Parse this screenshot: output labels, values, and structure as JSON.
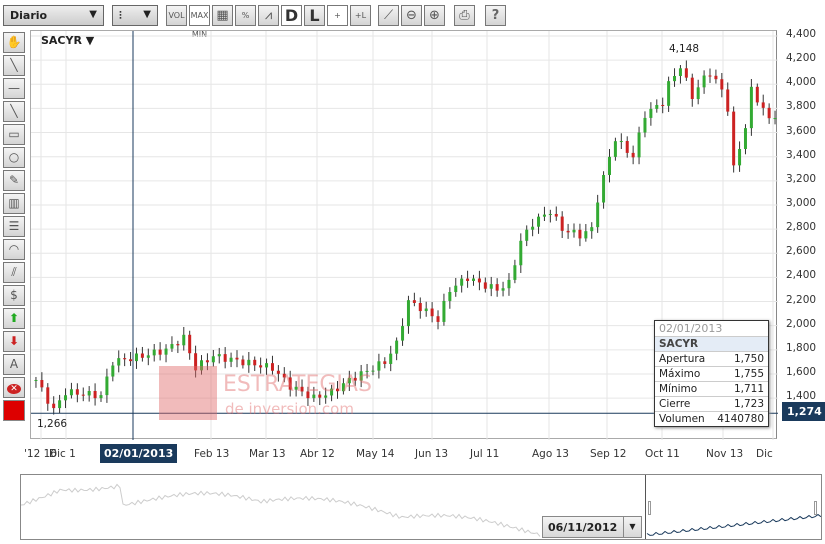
{
  "toolbar": {
    "period": "Diario",
    "chart_type_icon": "candlestick-icon",
    "buttons": [
      {
        "name": "volume",
        "label": "VOL"
      },
      {
        "name": "maxmin",
        "label": "MAX MIN"
      },
      {
        "name": "grid",
        "label": ""
      },
      {
        "name": "percent",
        "label": "%"
      },
      {
        "name": "area",
        "label": ""
      },
      {
        "name": "d",
        "label": "D"
      },
      {
        "name": "l",
        "label": "L"
      },
      {
        "name": "crosshair",
        "label": "+"
      },
      {
        "name": "crosshair-l",
        "label": "+L"
      },
      {
        "name": "draw",
        "label": ""
      },
      {
        "name": "zoom-out",
        "label": ""
      },
      {
        "name": "zoom-in",
        "label": ""
      },
      {
        "name": "print",
        "label": ""
      },
      {
        "name": "help",
        "label": "?"
      }
    ]
  },
  "left_tools": [
    "hand",
    "line",
    "horizontal-line",
    "diagonal",
    "rectangle",
    "circle",
    "pencil",
    "fibonacci-grid",
    "fibonacci-lines",
    "arcs",
    "channel",
    "dollar-channel",
    "up-arrow",
    "down-arrow",
    "text",
    "delete",
    "color"
  ],
  "symbol": "SACYR ▼",
  "watermark": {
    "title": "ESTRATEGIAS",
    "subtitle": "de inversion.com"
  },
  "cursor": {
    "date": "02/01/2013",
    "price": "1,274"
  },
  "labels": {
    "max": "4,148",
    "min": "1,266"
  },
  "tooltip": {
    "date": "02/01/2013",
    "symbol": "SACYR",
    "rows": [
      {
        "k": "Apertura",
        "v": "1,750"
      },
      {
        "k": "Máximo",
        "v": "1,755"
      },
      {
        "k": "Mínimo",
        "v": "1,711"
      },
      {
        "k": "Cierre",
        "v": "1,723"
      },
      {
        "k": "Volumen",
        "v": "4140780"
      }
    ]
  },
  "navigator": {
    "date": "06/11/2012"
  },
  "colors": {
    "up": "#33aa33",
    "down": "#cc2222",
    "crosshair": "#1a3a5c"
  },
  "chart_data": {
    "type": "candlestick",
    "title": "SACYR",
    "ylim": [
      1200,
      4450
    ],
    "yticks": [
      "4,400",
      "4,200",
      "4,000",
      "3,800",
      "3,600",
      "3,400",
      "3,200",
      "3,000",
      "2,800",
      "2,600",
      "2,400",
      "2,200",
      "2,000",
      "1,800",
      "1,600",
      "1,400"
    ],
    "xticks": [
      "'12 16",
      "Dic 1",
      "Feb 13",
      "Mar 13",
      "Abr 12",
      "May 14",
      "Jun 13",
      "Jul 11",
      "Ago 13",
      "Sep 12",
      "Oct 11",
      "Nov 13",
      "Dic"
    ],
    "close_anchors": [
      [
        0,
        1550
      ],
      [
        3,
        1300
      ],
      [
        5,
        1450
      ],
      [
        11,
        1420
      ],
      [
        13,
        1700
      ],
      [
        18,
        1750
      ],
      [
        22,
        1800
      ],
      [
        25,
        1900
      ],
      [
        27,
        1650
      ],
      [
        30,
        1750
      ],
      [
        35,
        1700
      ],
      [
        40,
        1650
      ],
      [
        43,
        1500
      ],
      [
        47,
        1400
      ],
      [
        50,
        1450
      ],
      [
        53,
        1550
      ],
      [
        57,
        1650
      ],
      [
        59,
        1700
      ],
      [
        61,
        1850
      ],
      [
        63,
        2200
      ],
      [
        65,
        2150
      ],
      [
        68,
        2050
      ],
      [
        70,
        2300
      ],
      [
        73,
        2400
      ],
      [
        75,
        2350
      ],
      [
        78,
        2300
      ],
      [
        80,
        2350
      ],
      [
        82,
        2700
      ],
      [
        84,
        2850
      ],
      [
        87,
        2950
      ],
      [
        89,
        2800
      ],
      [
        92,
        2750
      ],
      [
        94,
        2800
      ],
      [
        95,
        3050
      ],
      [
        97,
        3400
      ],
      [
        98,
        3550
      ],
      [
        101,
        3400
      ],
      [
        103,
        3750
      ],
      [
        106,
        3850
      ],
      [
        107,
        4000
      ],
      [
        109,
        4150
      ],
      [
        111,
        3900
      ],
      [
        113,
        4050
      ],
      [
        114,
        4100
      ],
      [
        116,
        3950
      ],
      [
        117,
        3800
      ],
      [
        118,
        3300
      ],
      [
        120,
        3650
      ],
      [
        121,
        3950
      ],
      [
        123,
        3800
      ],
      [
        124,
        3700
      ],
      [
        125,
        3750
      ]
    ]
  }
}
